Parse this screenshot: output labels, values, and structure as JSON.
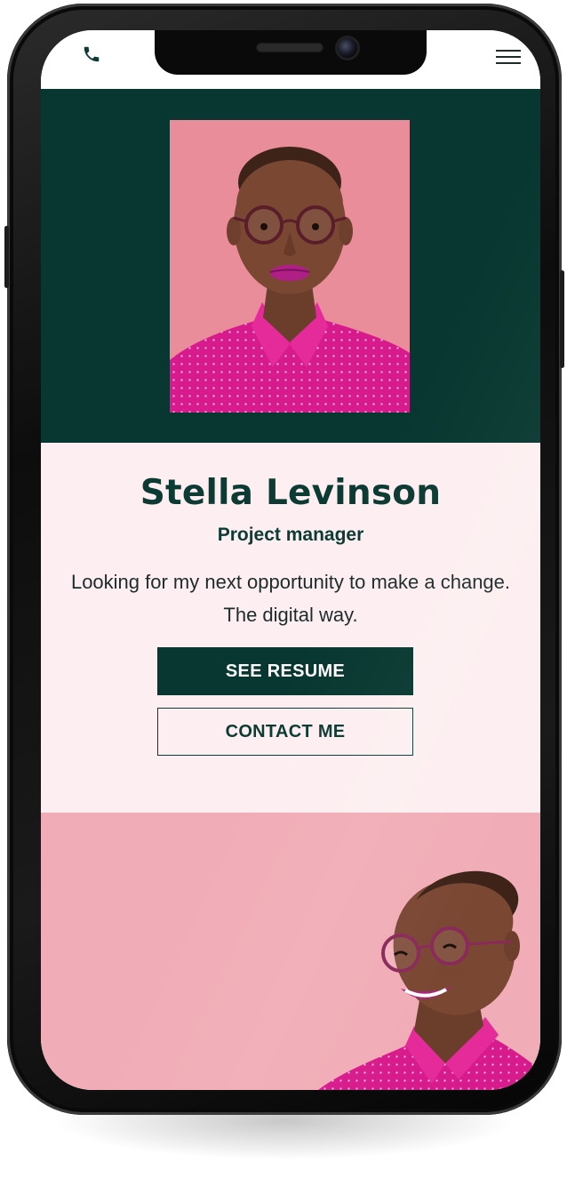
{
  "profile": {
    "name": "Stella Levinson",
    "role": "Project manager",
    "tagline_line1": "Looking for my next opportunity to make a change.",
    "tagline_line2": "The digital way."
  },
  "actions": {
    "primary_label": "SEE RESUME",
    "secondary_label": "CONTACT ME"
  },
  "icons": {
    "phone": "phone-icon",
    "menu": "hamburger-menu-icon"
  },
  "colors": {
    "brand_dark_green": "#073730",
    "heading_green": "#0c3b33",
    "info_background": "#fdeff1",
    "portrait_background": "#ea8d9b",
    "lower_background": "#f1adb7",
    "shirt_magenta": "#d81b8c"
  }
}
